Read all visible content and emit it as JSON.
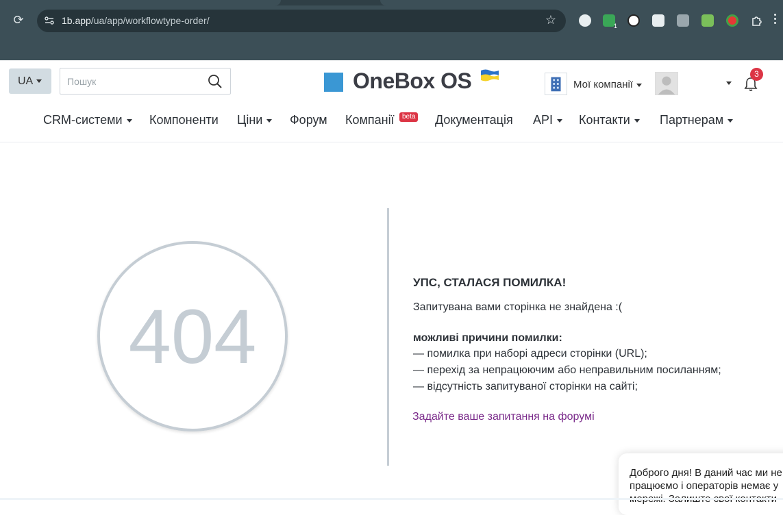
{
  "browser": {
    "url_host": "1b.app",
    "url_path": "/ua/app/workflowtype-order/",
    "extension_count_badge": "1"
  },
  "header": {
    "lang": "UA",
    "search_placeholder": "Пошук",
    "logo_text": "OneBox OS",
    "companies_label": "Мої компанії",
    "notifications_count": "3"
  },
  "nav": {
    "items": [
      "CRM-системи",
      "Компоненти",
      "Ціни",
      "Форум",
      "Компанії",
      "Документація",
      "API",
      "Контакти",
      "Партнерам"
    ],
    "beta_badge": "beta"
  },
  "error": {
    "code": "404",
    "title": "УПС, СТАЛАСЯ ПОМИЛКА!",
    "message": "Запитувана вами сторінка не знайдена :(",
    "reasons_title": "можливі причини помилки:",
    "reasons": [
      "— помилка при наборі адреси сторінки (URL);",
      "— перехід за непрацюючим або неправильним посиланням;",
      "— відсутність запитуваної сторінки на сайті;"
    ],
    "forum_link": "Задайте ваше запитання на форумі"
  },
  "chat": {
    "message": "Доброго дня! В даний час ми не працюємо і операторів немає у мережі. Залиште свої контакти"
  },
  "colors": {
    "logo_blue": "#3a97d4",
    "circle_gray": "#c5cdd4",
    "link_purple": "#7a2a8a",
    "badge_red": "#dc3545"
  }
}
